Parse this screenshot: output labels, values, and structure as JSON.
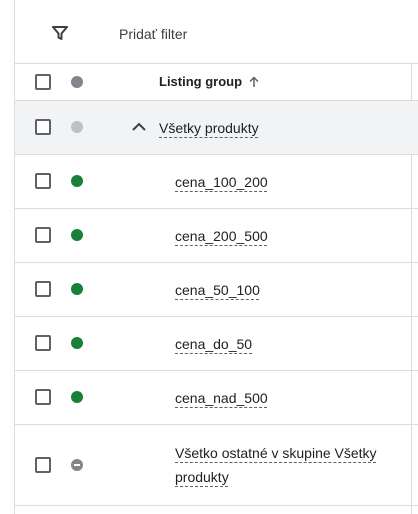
{
  "filter": {
    "icon": "filter-icon",
    "label": "Pridať filter"
  },
  "table": {
    "header": {
      "column_label": "Listing group",
      "sort_icon": "arrow-up-icon"
    },
    "group": {
      "label": "Všetky produkty",
      "status": "gray",
      "expanded": true
    },
    "items": [
      {
        "label": "cena_100_200",
        "status": "active"
      },
      {
        "label": "cena_200_500",
        "status": "active"
      },
      {
        "label": "cena_50_100",
        "status": "active"
      },
      {
        "label": "cena_do_50",
        "status": "active"
      },
      {
        "label": "cena_nad_500",
        "status": "active"
      }
    ],
    "other": {
      "label": "Všetko ostatné v skupine Všetky produkty",
      "status": "excluded"
    }
  },
  "colors": {
    "active_dot": "#188038",
    "header_dot": "#80868b",
    "group_row_bg": "#f1f3f4",
    "divider": "#dadce0"
  }
}
